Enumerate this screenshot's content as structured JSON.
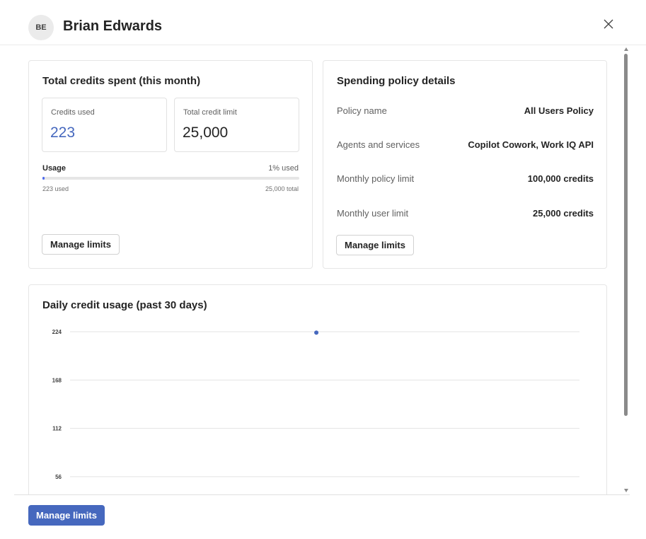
{
  "header": {
    "avatar_initials": "BE",
    "user_name": "Brian Edwards",
    "close_icon": "close-icon"
  },
  "credits_card": {
    "title": "Total credits spent (this month)",
    "credits_used_label": "Credits used",
    "credits_used_value": "223",
    "credit_limit_label": "Total credit limit",
    "credit_limit_value": "25,000",
    "usage_label": "Usage",
    "usage_pct_text": "1% used",
    "usage_fraction": 0.0089,
    "used_small": "223 used",
    "total_small": "25,000 total",
    "manage_label": "Manage limits",
    "accent_color": "#4668be",
    "fill_color": "#4f6bed"
  },
  "policy_card": {
    "title": "Spending policy details",
    "rows": [
      {
        "label": "Policy name",
        "value": "All Users Policy"
      },
      {
        "label": "Agents and services",
        "value": "Copilot Cowork, Work IQ API"
      },
      {
        "label": "Monthly policy limit",
        "value": "100,000 credits"
      },
      {
        "label": "Monthly user limit",
        "value": "25,000 credits"
      }
    ],
    "manage_label": "Manage limits"
  },
  "chart_card": {
    "title": "Daily credit usage (past 30 days)"
  },
  "chart_data": {
    "type": "scatter",
    "title": "Daily credit usage (past 30 days)",
    "xlabel": "",
    "ylabel": "",
    "y_ticks": [
      224,
      168,
      112,
      56
    ],
    "ylim": [
      0,
      224
    ],
    "x_count": 30,
    "points": [
      {
        "x": 15,
        "y": 223
      }
    ],
    "point_color": "#4668be",
    "grid": true
  },
  "footer": {
    "primary_label": "Manage limits"
  }
}
